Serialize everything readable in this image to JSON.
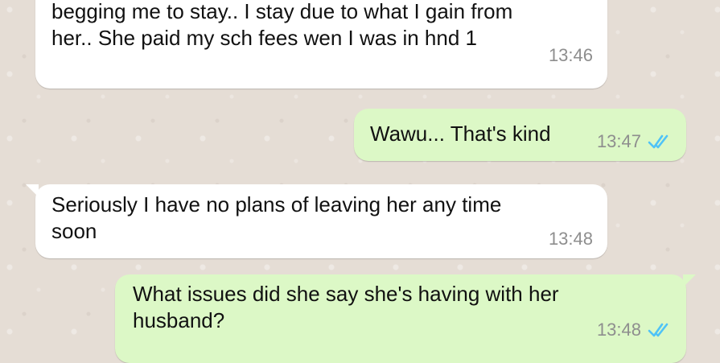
{
  "colors": {
    "background": "#e5ddd5",
    "incoming_bubble": "#ffffff",
    "outgoing_bubble": "#dcf8c6",
    "timestamp": "#8e8e8e",
    "read_ticks": "#4fc3f7"
  },
  "messages": [
    {
      "direction": "incoming",
      "text": "begging me to stay..  I stay due to what I gain from\nher.. She paid my sch fees wen I was in hnd 1",
      "time": "13:46"
    },
    {
      "direction": "outgoing",
      "text": "Wawu... That's kind",
      "time": "13:47",
      "status_icon": "double-check-read-icon"
    },
    {
      "direction": "incoming",
      "text": "Seriously I have no plans of leaving her any time\nsoon",
      "time": "13:48"
    },
    {
      "direction": "outgoing",
      "text": "What issues did she say she's having with her\nhusband?",
      "time": "13:48",
      "status_icon": "double-check-read-icon"
    }
  ]
}
